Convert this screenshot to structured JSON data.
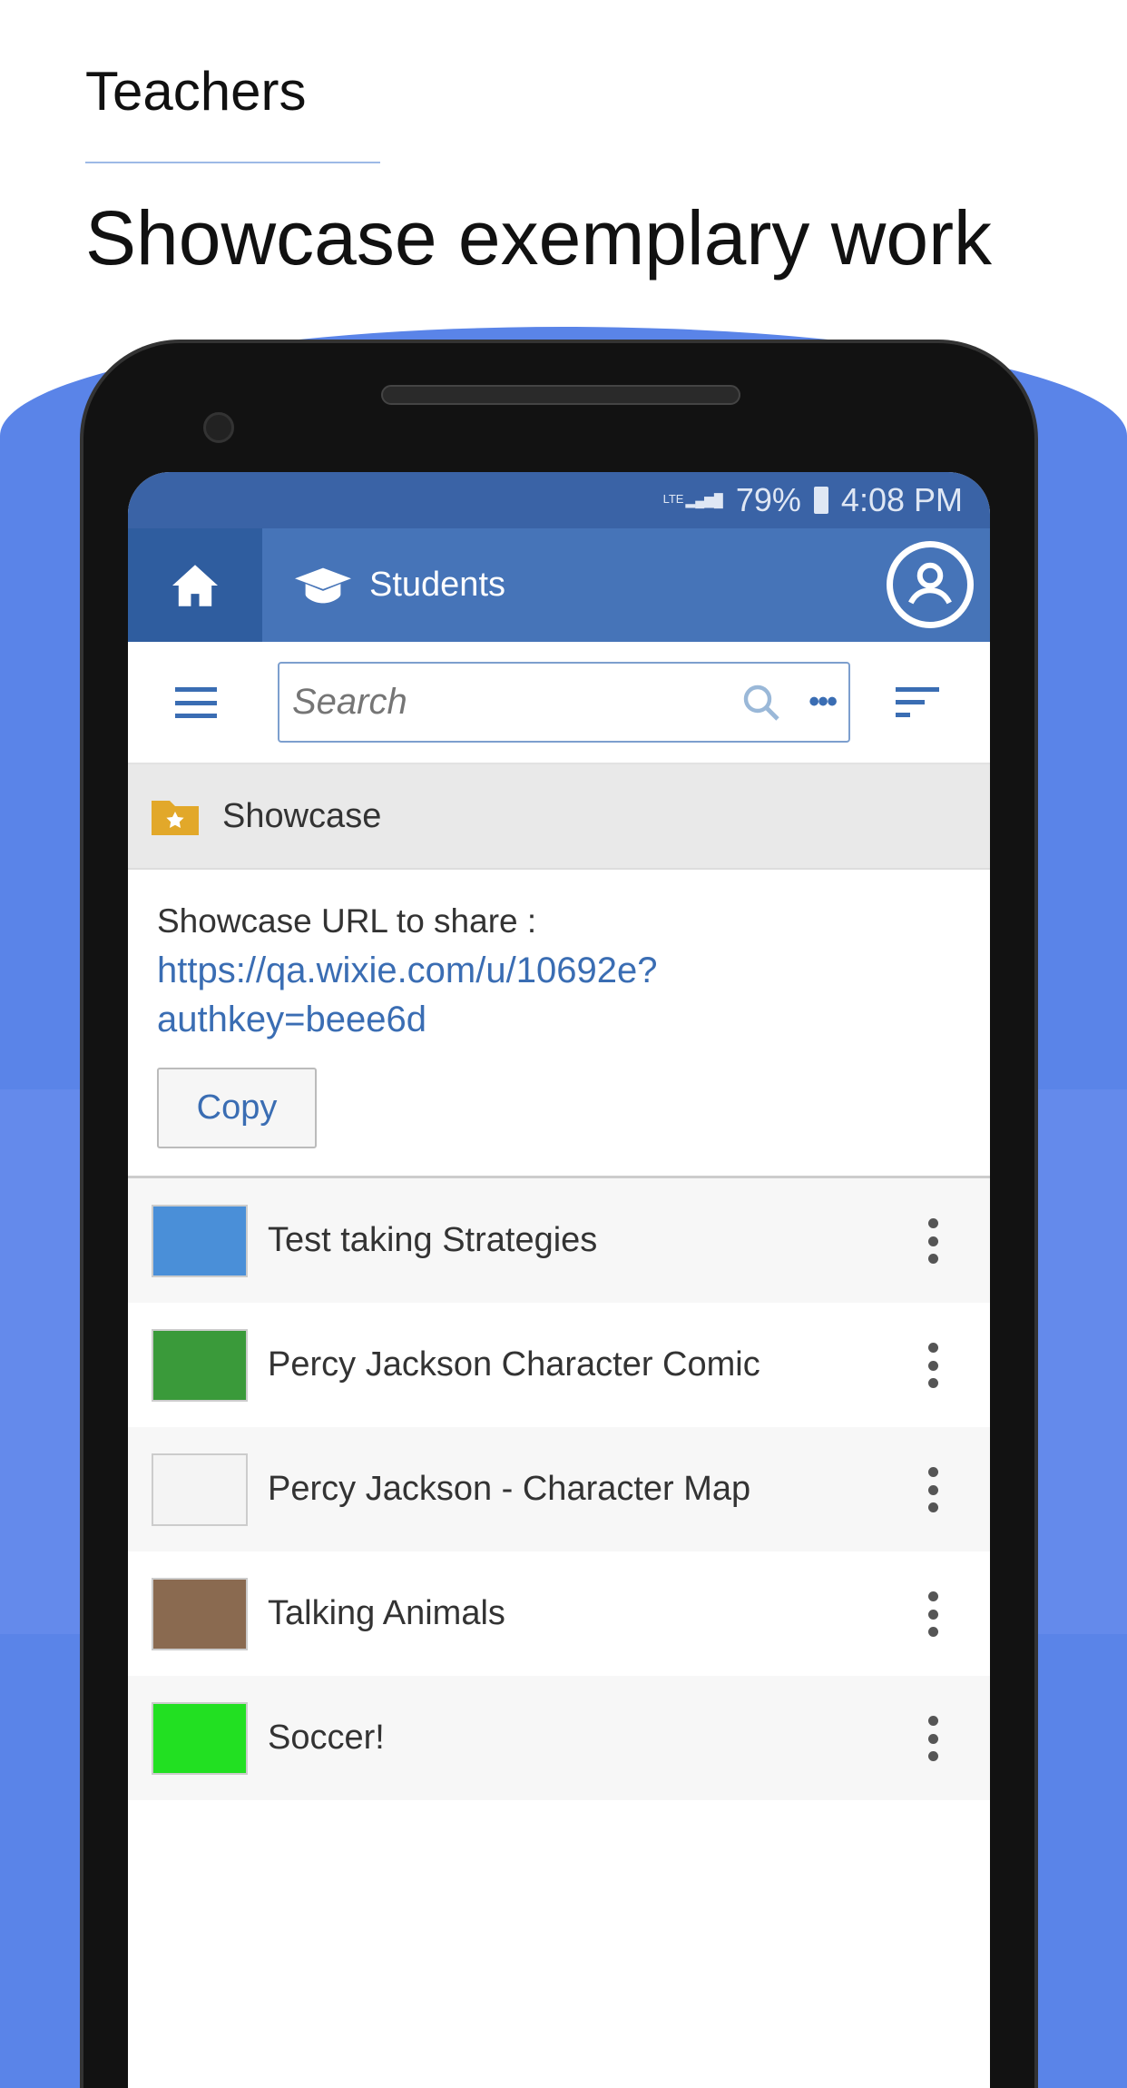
{
  "promo": {
    "kicker": "Teachers",
    "headline": "Showcase exemplary work"
  },
  "status_bar": {
    "network": "LTE",
    "battery": "79%",
    "time": "4:08 PM"
  },
  "header": {
    "title": "Students"
  },
  "search": {
    "placeholder": "Search"
  },
  "folder": {
    "name": "Showcase"
  },
  "share": {
    "label": "Showcase URL to share :",
    "url_line1": "https://qa.wixie.com/u/10692e?",
    "url_line2": "authkey=beee6d",
    "copy_label": "Copy"
  },
  "items": [
    {
      "title": "Test taking Strategies",
      "thumb_color": "#4a8fd8"
    },
    {
      "title": "Percy Jackson Character Comic",
      "thumb_color": "#3a9a3a"
    },
    {
      "title": "Percy Jackson - Character Map",
      "thumb_color": "#f4f4f4"
    },
    {
      "title": "Talking Animals",
      "thumb_color": "#8a6a50"
    },
    {
      "title": "Soccer!",
      "thumb_color": "#22e022"
    }
  ],
  "colors": {
    "accent": "#4674b8",
    "status_bar": "#3a63a6",
    "link": "#3a6db3",
    "folder": "#e2a82a"
  }
}
